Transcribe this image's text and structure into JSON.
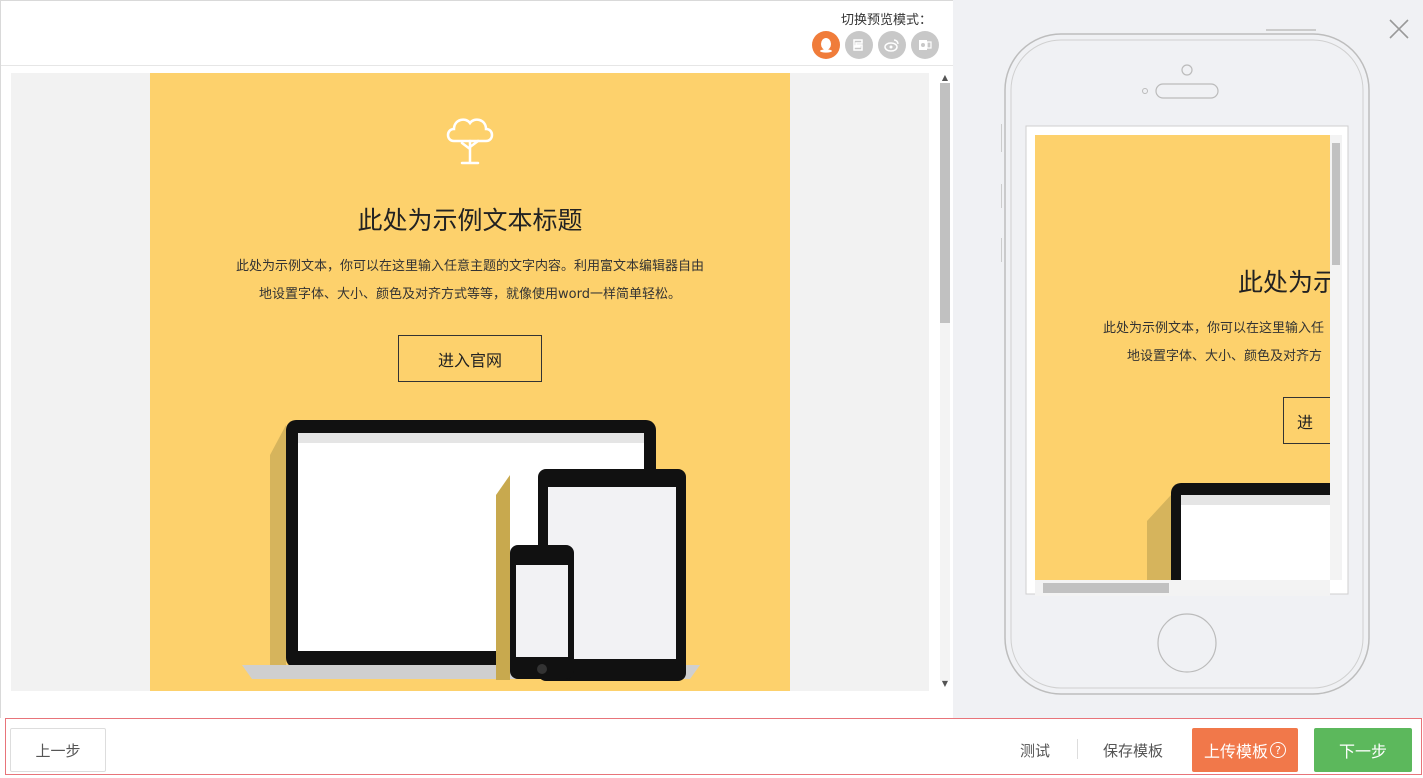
{
  "toolbar": {
    "preview_mode_label": "切换预览模式：",
    "modes": [
      {
        "name": "qq-mail",
        "glyph": "🐧"
      },
      {
        "name": "163-mail",
        "glyph": "易"
      },
      {
        "name": "weibo",
        "glyph": "微"
      },
      {
        "name": "outlook",
        "glyph": "O"
      }
    ]
  },
  "email_preview": {
    "title": "此处为示例文本标题",
    "body_line1": "此处为示例文本，你可以在这里输入任意主题的文字内容。利用富文本编辑器自由",
    "body_line2": "地设置字体、大小、颜色及对齐方式等等，就像使用word一样简单轻松。",
    "button_label": "进入官网"
  },
  "mobile_preview": {
    "title": "此处为示",
    "body_line1": "此处为示例文本，你可以在这里输入任",
    "body_line2": "地设置字体、大小、颜色及对齐方",
    "button_label": "进"
  },
  "footer": {
    "prev_label": "上一步",
    "test_label": "测试",
    "save_template_label": "保存模板",
    "upload_template_label": "上传模板",
    "help_glyph": "?",
    "next_label": "下一步"
  },
  "colors": {
    "card_bg": "#fdd16c",
    "upload_button": "#f1784a",
    "next_button": "#5cb85c",
    "active_mode": "#f07c3a",
    "footer_border": "#e8747a"
  }
}
